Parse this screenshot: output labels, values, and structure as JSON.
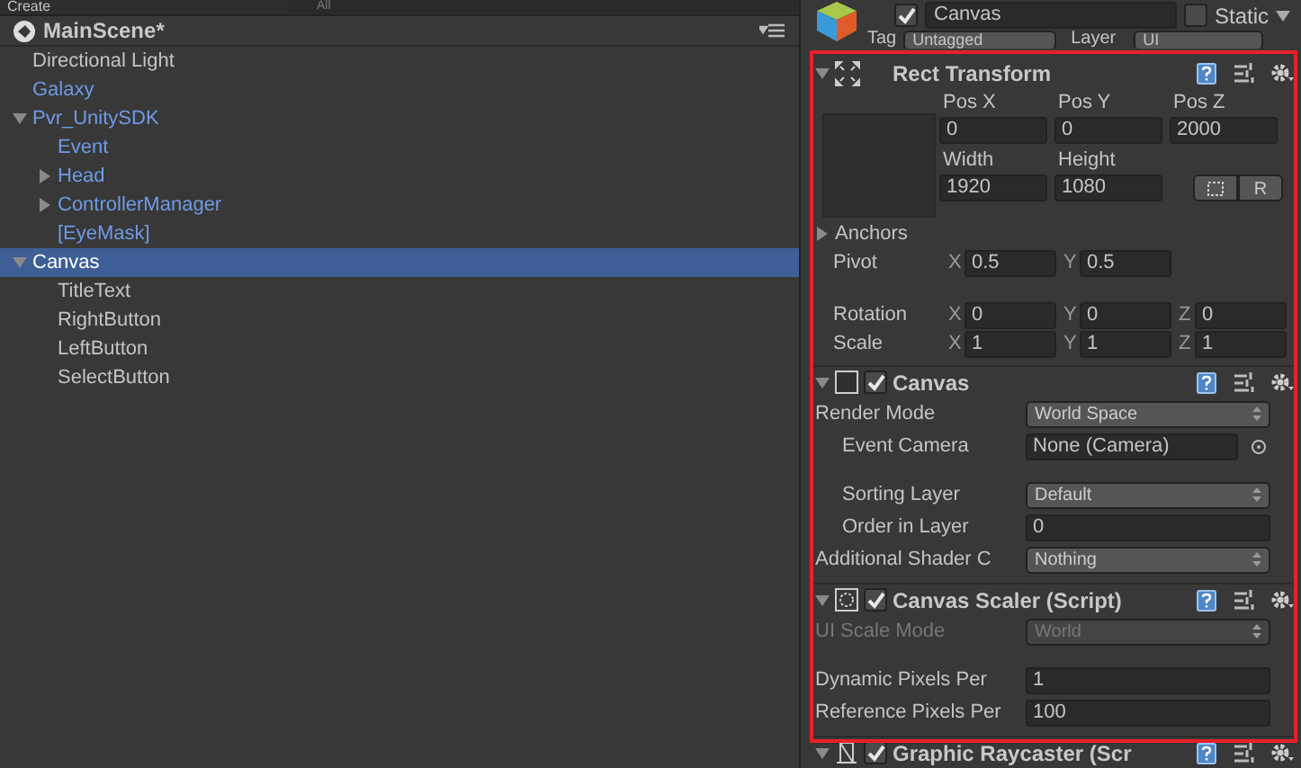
{
  "hierarchy": {
    "create_button": "Create",
    "search_placeholder": "All",
    "scene_title": "MainScene*",
    "items": [
      {
        "label": "Directional Light",
        "prefab": false,
        "selected": false
      },
      {
        "label": "Galaxy",
        "prefab": true,
        "selected": false
      },
      {
        "label": "Pvr_UnitySDK",
        "prefab": true,
        "selected": false,
        "expanded": true,
        "children": [
          {
            "label": "Event",
            "prefab": true,
            "selected": false
          },
          {
            "label": "Head",
            "prefab": true,
            "selected": false,
            "expanded": false
          },
          {
            "label": "ControllerManager",
            "prefab": true,
            "selected": false,
            "expanded": false
          },
          {
            "label": "[EyeMask]",
            "prefab": true,
            "selected": false
          }
        ]
      },
      {
        "label": "Canvas",
        "prefab": false,
        "selected": true,
        "expanded": true,
        "children": [
          {
            "label": "TitleText",
            "prefab": false,
            "selected": false
          },
          {
            "label": "RightButton",
            "prefab": false,
            "selected": false
          },
          {
            "label": "LeftButton",
            "prefab": false,
            "selected": false
          },
          {
            "label": "SelectButton",
            "prefab": false,
            "selected": false
          }
        ]
      }
    ]
  },
  "inspector": {
    "object": {
      "active": true,
      "name": "Canvas",
      "static_label": "Static",
      "static": false,
      "tag_label": "Tag",
      "tag": "Untagged",
      "layer_label": "Layer",
      "layer": "UI"
    },
    "rect_transform": {
      "title": "Rect Transform",
      "expanded": true,
      "pos_fields": [
        {
          "label": "Pos X",
          "value": "0"
        },
        {
          "label": "Pos Y",
          "value": "0"
        },
        {
          "label": "Pos Z",
          "value": "2000"
        }
      ],
      "size_fields": [
        {
          "label": "Width",
          "value": "1920"
        },
        {
          "label": "Height",
          "value": "1080"
        }
      ],
      "raw_button": "R",
      "anchors_label": "Anchors",
      "anchors_expanded": false,
      "pivot": {
        "label": "Pivot",
        "axes": [
          {
            "axis": "X",
            "value": "0.5"
          },
          {
            "axis": "Y",
            "value": "0.5"
          }
        ]
      },
      "transform_rows": [
        {
          "label": "Rotation",
          "axes": [
            {
              "axis": "X",
              "value": "0"
            },
            {
              "axis": "Y",
              "value": "0"
            },
            {
              "axis": "Z",
              "value": "0"
            }
          ]
        },
        {
          "label": "Scale",
          "axes": [
            {
              "axis": "X",
              "value": "1"
            },
            {
              "axis": "Y",
              "value": "1"
            },
            {
              "axis": "Z",
              "value": "1"
            }
          ]
        }
      ]
    },
    "components": [
      {
        "kind": "canvas",
        "title": "Canvas",
        "expanded": true,
        "enabled": true,
        "groups": [
          [
            {
              "kind": "dropdown",
              "label": "Render Mode",
              "value": "World Space",
              "indented": false,
              "disabled": false
            },
            {
              "kind": "object",
              "label": "Event Camera",
              "value": "None (Camera)",
              "indented": true,
              "disabled": false
            }
          ],
          [
            {
              "kind": "dropdown",
              "label": "Sorting Layer",
              "value": "Default",
              "indented": true,
              "disabled": false
            },
            {
              "kind": "number",
              "label": "Order in Layer",
              "value": "0",
              "indented": true,
              "disabled": false
            },
            {
              "kind": "dropdown",
              "label": "Additional Shader C",
              "value": "Nothing",
              "indented": false,
              "disabled": false
            }
          ]
        ]
      },
      {
        "kind": "scaler",
        "title": "Canvas Scaler (Script)",
        "expanded": true,
        "enabled": true,
        "groups": [
          [
            {
              "kind": "dropdown",
              "label": "UI Scale Mode",
              "value": "World",
              "indented": false,
              "disabled": true
            }
          ],
          [
            {
              "kind": "number",
              "label": "Dynamic Pixels Per",
              "value": "1",
              "indented": false,
              "disabled": false
            },
            {
              "kind": "number",
              "label": "Reference Pixels Per",
              "value": "100",
              "indented": false,
              "disabled": false
            }
          ]
        ]
      },
      {
        "kind": "raycaster",
        "title": "Graphic Raycaster (Scr",
        "expanded": true,
        "enabled": true
      }
    ]
  }
}
